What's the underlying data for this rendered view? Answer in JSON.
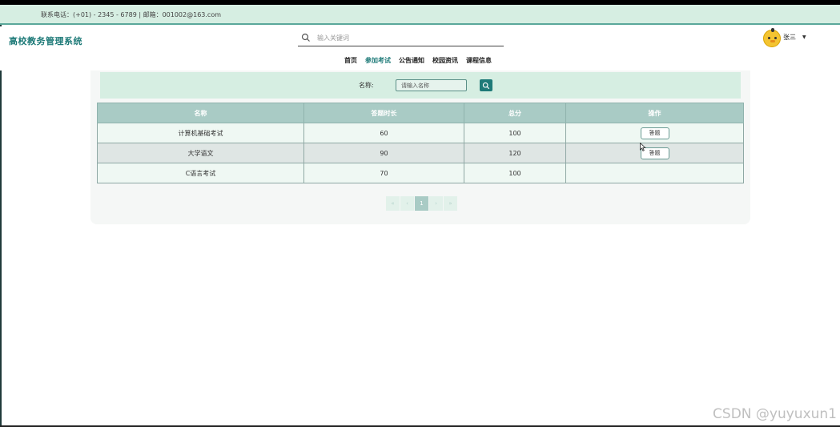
{
  "topbar": {
    "contact": "联系电话：(+01) - 2345 - 6789  |  邮箱：001002@163.com"
  },
  "header": {
    "site_title": "高校教务管理系统",
    "search_placeholder": "输入关键词",
    "user_name": "张三"
  },
  "nav": {
    "items": [
      {
        "label": "首页",
        "active": false
      },
      {
        "label": "参加考试",
        "active": true
      },
      {
        "label": "公告通知",
        "active": false
      },
      {
        "label": "校园资讯",
        "active": false
      },
      {
        "label": "课程信息",
        "active": false
      }
    ]
  },
  "filter": {
    "label": "名称:",
    "placeholder": "请输入名称"
  },
  "table": {
    "columns": [
      "名称",
      "答题时长",
      "总分",
      "操作"
    ],
    "rows": [
      {
        "name": "计算机基础考试",
        "duration": "60",
        "score": "100",
        "action": "答题"
      },
      {
        "name": "大学语文",
        "duration": "90",
        "score": "120",
        "action": "答题"
      },
      {
        "name": "C语言考试",
        "duration": "70",
        "score": "100",
        "action": ""
      }
    ]
  },
  "pager": {
    "first": "«",
    "prev": "‹",
    "current": "1",
    "next": "›",
    "last": "»"
  },
  "watermark": "CSDN @yuyuxun1",
  "colors": {
    "accent": "#1e7a78",
    "topbar_bg": "#d6eee2",
    "table_header": "#a9cbc5"
  }
}
